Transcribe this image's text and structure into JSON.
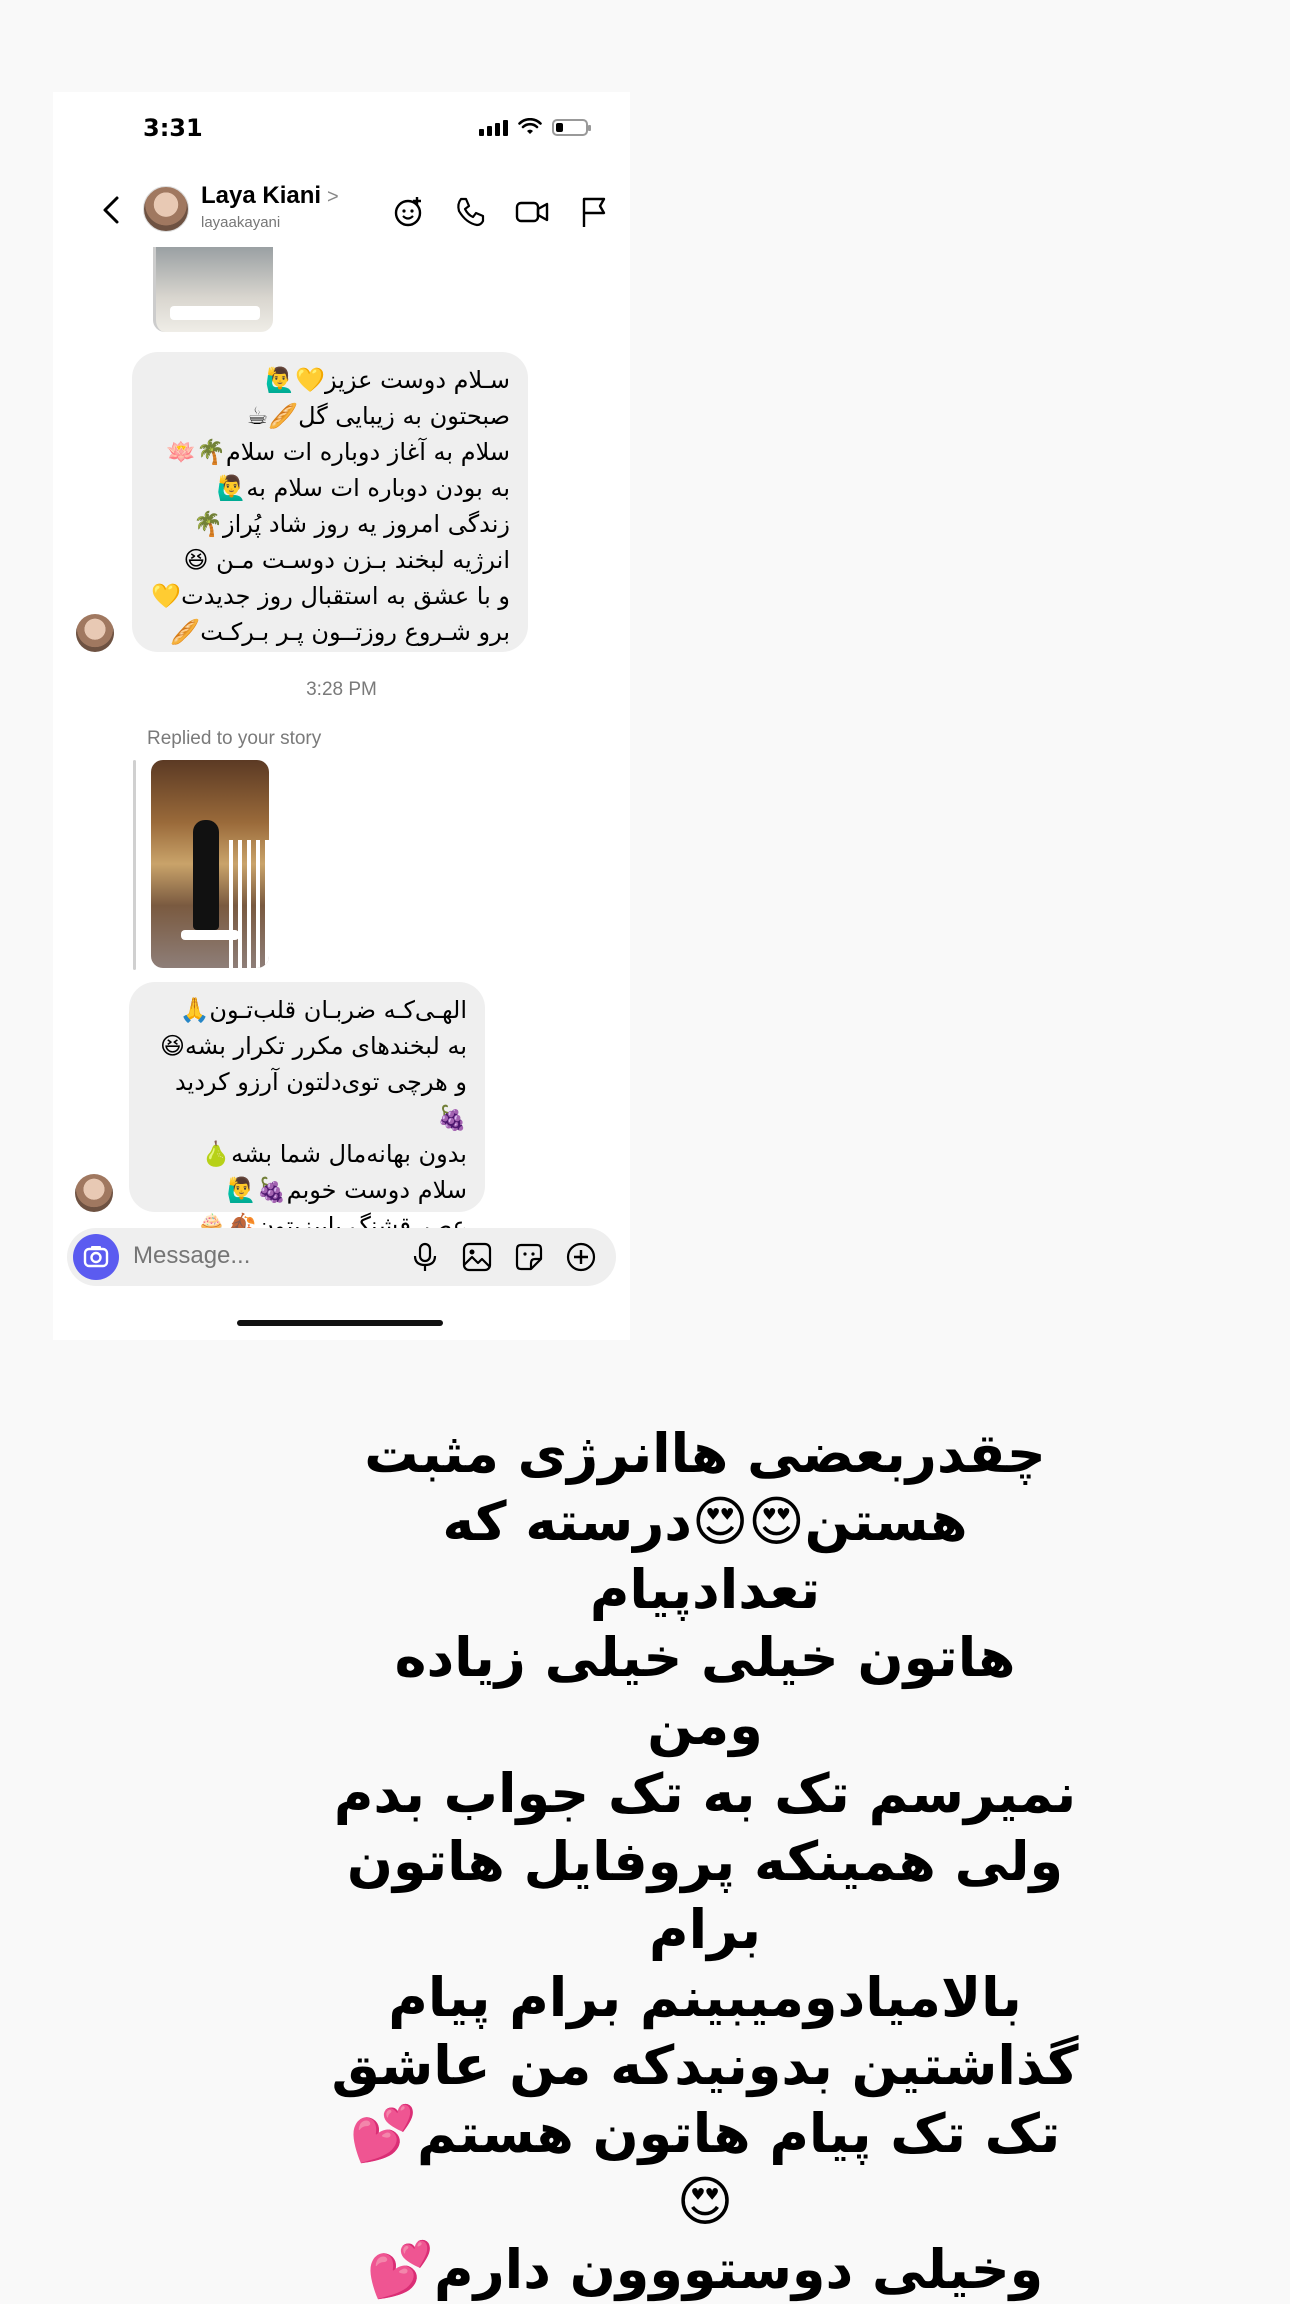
{
  "status_bar": {
    "time": "3:31"
  },
  "header": {
    "contact_name": "Laya Kiani",
    "chevron": ">",
    "username": "layaakayani",
    "icons": [
      "back-chevron-icon",
      "add-effect-icon",
      "phone-icon",
      "video-icon",
      "flag-icon"
    ]
  },
  "messages": {
    "bubble1": "سـلام دوست عزیز💛🙋‍♂️\nصبحتون به زیبایی گل🥖☕\nسلام به آغاز دوباره ات سلام🌴🪷\nبه بودن دوباره ات سلام به🙋‍♂️\nزندگی امروز یه روز شاد پُراز🌴\nانرژیه لبخند بـزن دوسـت مـن 😆\nو با عشق به استقبال روز جدیدت💛\nبرو شـروع روزتــون پـر بـرکـت🥖",
    "timestamp": "3:28 PM",
    "replied_label": "Replied to your story",
    "bubble2": "الهـی‌کـه ضربـان قلب‌تـون🙏\nبه لبخندهای مکرر تکرار بشه😆\nو هرچی توی‌دلتون آرزو کردید🍇\nبدون بهانه‌مال شما بشه🍐\nسلام دوست خوبم🍇🙋‍♂️\nعصر قشنگ پاییزیتون🍂🧁"
  },
  "composer": {
    "placeholder": "Message...",
    "icons": [
      "camera-icon",
      "microphone-icon",
      "gallery-icon",
      "sticker-icon",
      "plus-icon"
    ]
  },
  "caption": "چقدربعضی هاانرژی مثبت\nهستن😍😍درسته که تعدادپیام\nهاتون خیلی خیلی زیاده ومن\nنمیرسم تک به تک جواب بدم\nولی همینکه پروفایل هاتون برام\nبالامیادومیبینم برام پیام\nگذاشتین بدونیدکه من عاشق\nتک تک پیام هاتون هستم💕😍\nوخیلی دوستووون دارم💕",
  "colors": {
    "accent": "#5b5bf0",
    "bubble_bg": "#efefef"
  }
}
